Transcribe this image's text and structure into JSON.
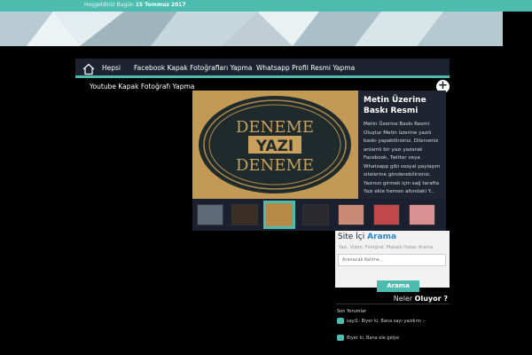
{
  "topbar": {
    "welcome_prefix": "Hoşgeldiniz Bugün",
    "date": "15 Temmuz 2017"
  },
  "nav": {
    "items": [
      {
        "label": "Hepsi"
      },
      {
        "label": "Facebook Kapak Fotoğrafları Yapma"
      },
      {
        "label": "Whatsapp Profil Resmi Yapma"
      }
    ],
    "sub_item": "Youtube Kapak Fotoğrafı Yapma"
  },
  "slider": {
    "image_text": {
      "line1": "DENEME",
      "line2": "YAZI",
      "line3": "DENEME"
    },
    "title": "Metin Üzerine Baskı Resmi",
    "description": "Metin Üzerine Baskı Resmi Oluştur Metin üzerine yazılı baskı yapabilirsiniz. Dilerseniz anlamlı bir yazı yazarak Facebook, Twitter veya Whatsapp gibi sosyal paylaşım sitelerine gönderebilirsiniz. Yazınızı girmek için sağ tarafta Yazı ekle hemen altındaki Y...",
    "thumbs": [
      {
        "color": "#5c6a78"
      },
      {
        "color": "#3b2f24"
      },
      {
        "color": "#b68a46"
      },
      {
        "color": "#2a2a2e"
      },
      {
        "color": "#c98a78"
      },
      {
        "color": "#c0474a"
      },
      {
        "color": "#d89090"
      }
    ]
  },
  "search": {
    "title_plain": "Site İçi",
    "title_bold": "Arama",
    "subtitle": "Yazı, Video, Fotoğraf, Makale Haber Arama",
    "placeholder": "Aranacak Kelime...",
    "button_label": "Arama"
  },
  "feed": {
    "title_plain": "Neler",
    "title_bold": "Oluyor ?",
    "header": "Son Yorumlar",
    "items": [
      {
        "text": "sayi1: Biyer ki, Bana sayı yazdırın :-"
      },
      {
        "text": "Biyer ki, Bana ele gelye"
      }
    ]
  },
  "colors": {
    "accent": "#4bbcad",
    "nav_bg": "#1c2230",
    "link": "#2a86c6"
  }
}
